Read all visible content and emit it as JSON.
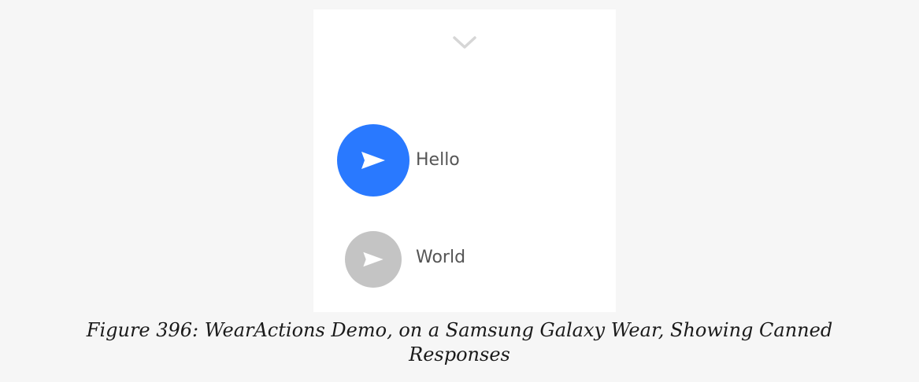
{
  "watch": {
    "chevron_icon": "chevron-down-icon",
    "replies": [
      {
        "label": "Hello",
        "icon": "send-icon",
        "color": "#2979ff"
      },
      {
        "label": "World",
        "icon": "send-icon",
        "color": "#c4c4c4"
      }
    ]
  },
  "caption": {
    "line1": "Figure 396: WearActions Demo, on a Samsung Galaxy Wear, Showing Canned",
    "line2": "Responses"
  },
  "colors": {
    "page_background": "#f6f6f6",
    "screen_background": "#ffffff",
    "label_text": "#555555"
  }
}
